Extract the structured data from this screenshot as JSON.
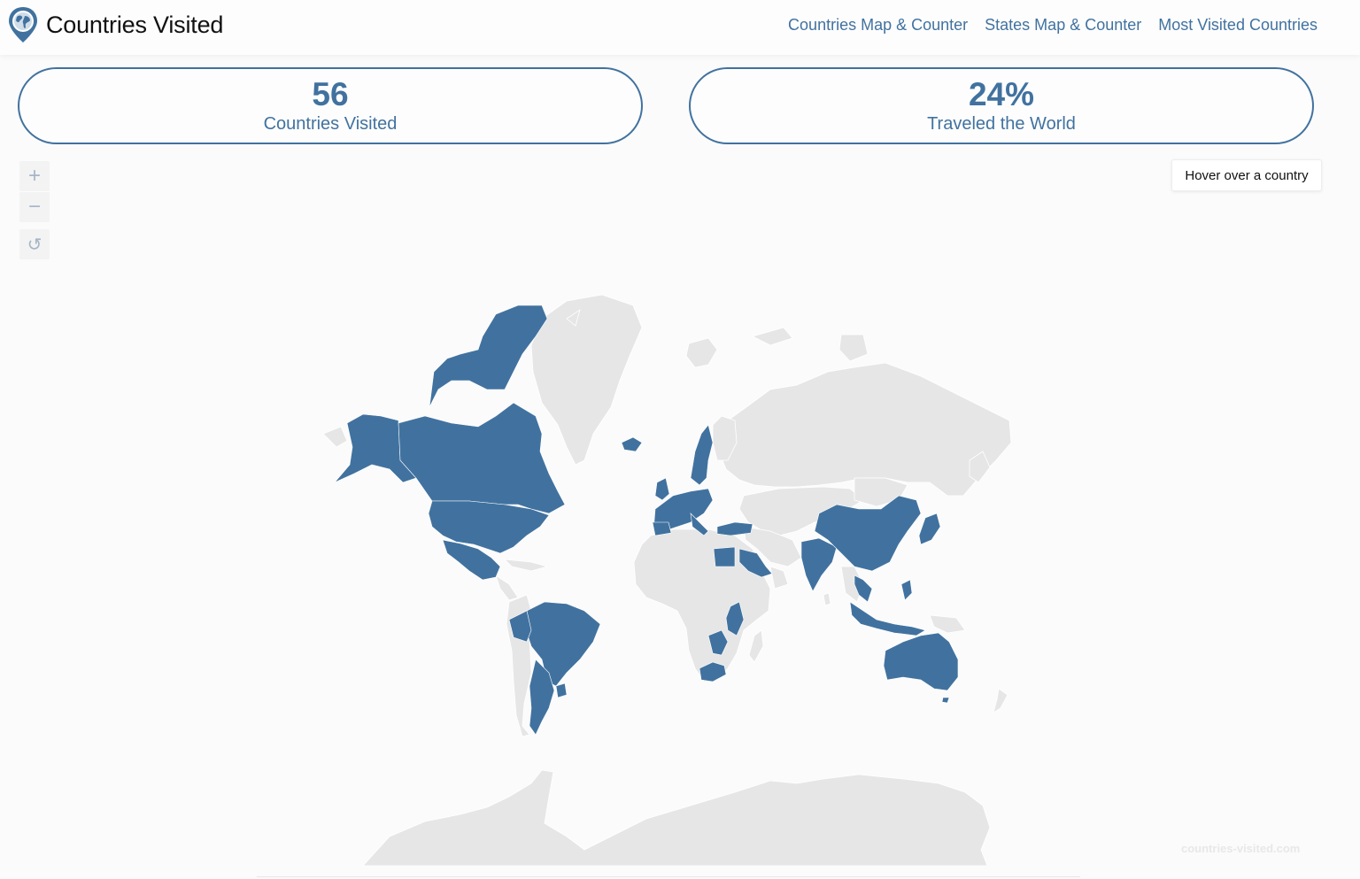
{
  "app": {
    "title": "Countries Visited"
  },
  "nav": {
    "links": [
      {
        "label": "Countries Map & Counter"
      },
      {
        "label": "States Map & Counter"
      },
      {
        "label": "Most Visited Countries"
      }
    ]
  },
  "stats": {
    "countries_value": "56",
    "countries_label": "Countries Visited",
    "percent_value": "24%",
    "percent_label": "Traveled the World"
  },
  "map_controls": {
    "zoom_in": "+",
    "zoom_out": "−",
    "reset": "↺"
  },
  "tooltip": {
    "text": "Hover over a country"
  },
  "watermark": "countries-visited.com",
  "colors": {
    "accent": "#41729f",
    "visited": "#41729f",
    "unvisited": "#e6e6e6"
  },
  "icons": {
    "brand": "globe-pin-icon",
    "zoom_in": "plus-icon",
    "zoom_out": "minus-icon",
    "reset": "reset-icon"
  }
}
